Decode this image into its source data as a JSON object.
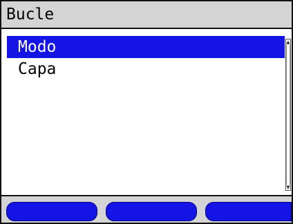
{
  "title_bar": {
    "title": "Bucle"
  },
  "menu": {
    "items": [
      {
        "label": "Modo",
        "selected": true
      },
      {
        "label": "Capa",
        "selected": false
      }
    ]
  },
  "scrollbar": {
    "up_icon": "scroll-up-arrow",
    "down_icon": "scroll-down-arrow"
  },
  "softkeys": {
    "key1_label": "",
    "key2_label": "",
    "key3_label": ""
  },
  "colors": {
    "selection": "#1414e6",
    "title_bar": "#d4d4d4",
    "softkey": "#1414e6"
  }
}
